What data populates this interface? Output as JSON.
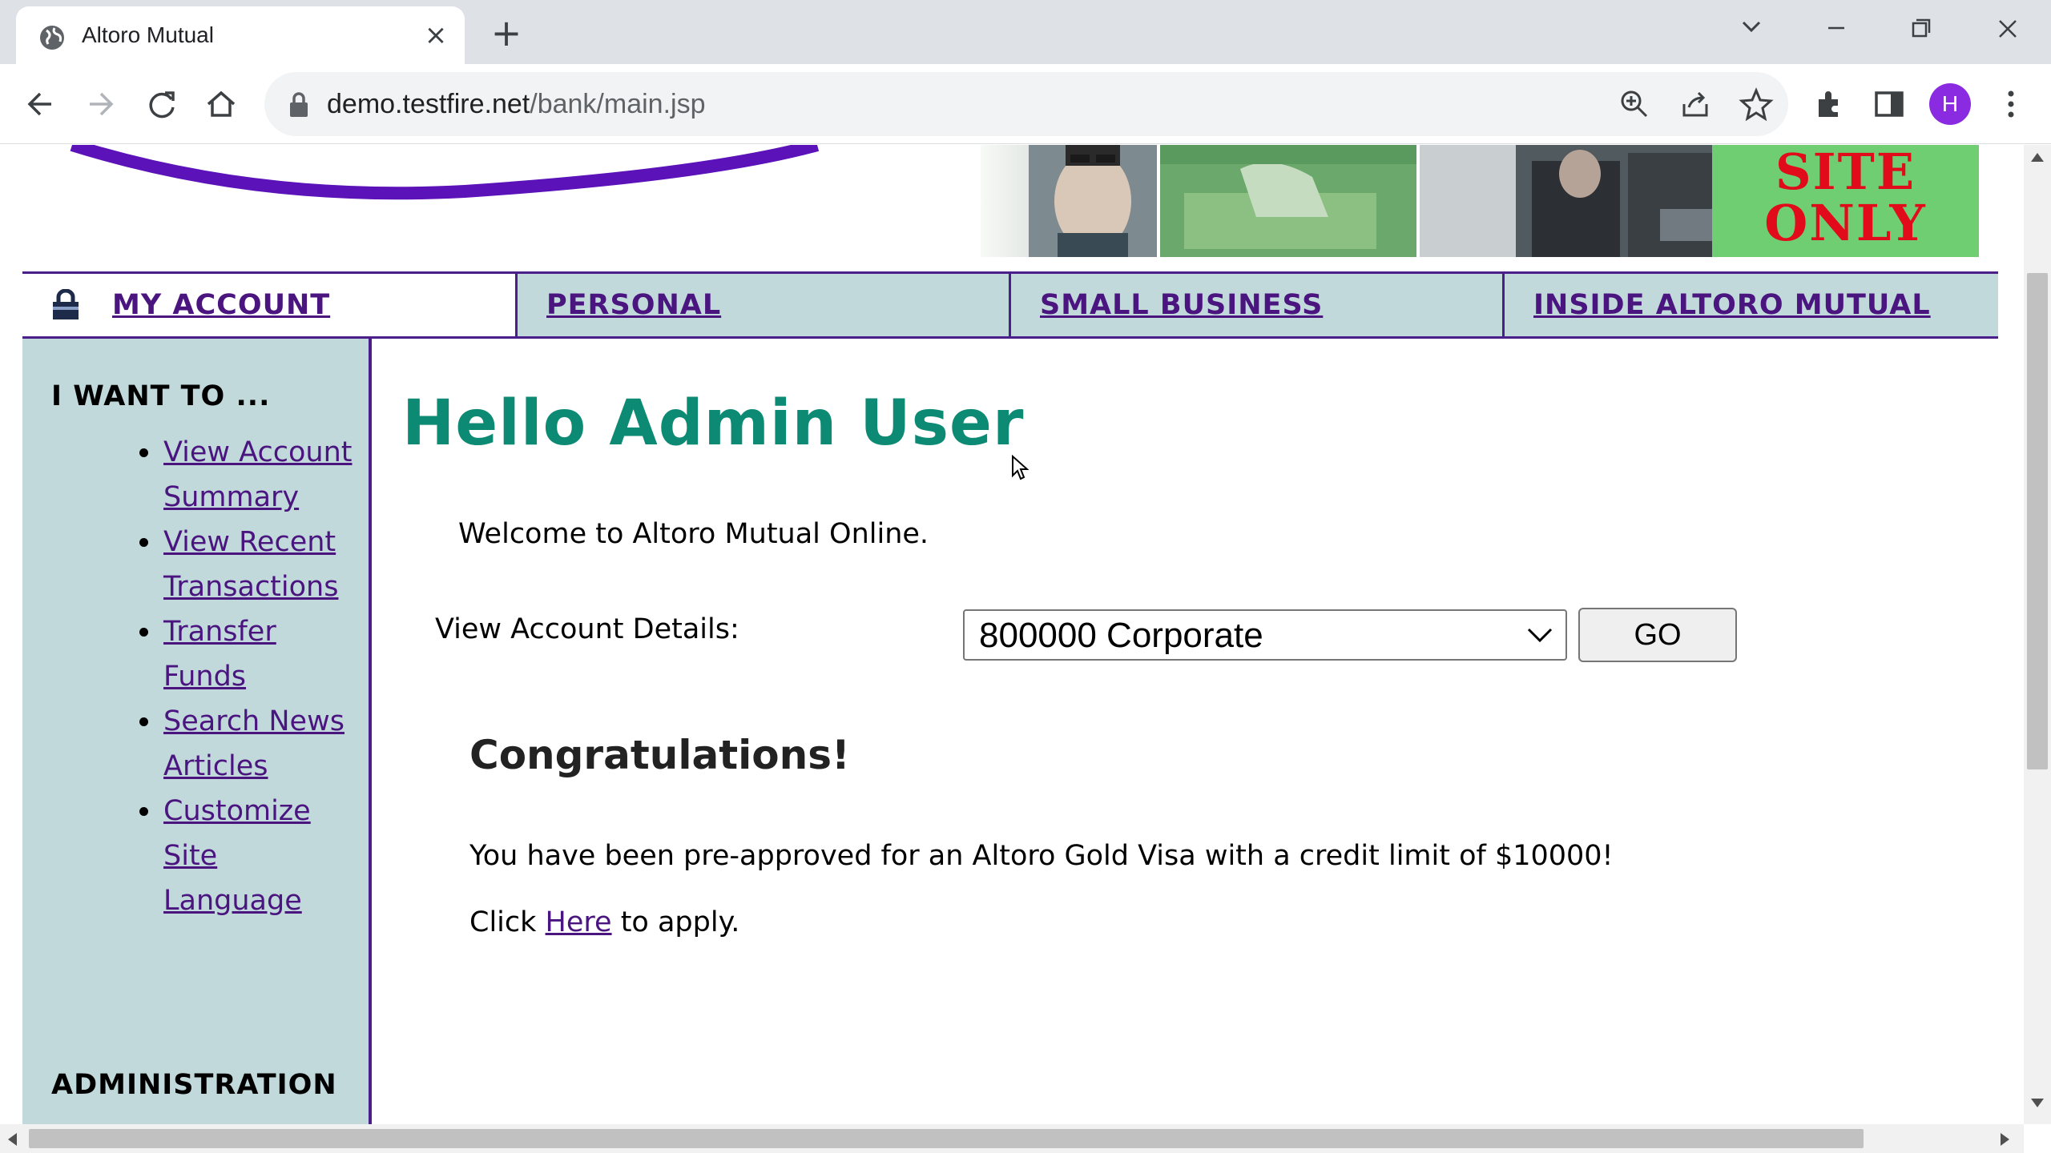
{
  "browser": {
    "tab_title": "Altoro Mutual",
    "url_host": "demo.testfire.net",
    "url_path": "/bank/main.jsp",
    "profile_initial": "H",
    "profile_color": "#8a2be2"
  },
  "banner": {
    "site_only_line1": "SITE",
    "site_only_line2": "ONLY"
  },
  "topnav": {
    "my_account": "MY ACCOUNT",
    "personal": "PERSONAL",
    "small_business": "SMALL BUSINESS",
    "inside": "INSIDE ALTORO MUTUAL"
  },
  "sidebar": {
    "heading": "I WANT TO ...",
    "items": [
      {
        "label": "View Account Summary"
      },
      {
        "label": "View Recent Transactions"
      },
      {
        "label": "Transfer Funds"
      },
      {
        "label": "Search News Articles"
      },
      {
        "label": "Customize Site Language"
      }
    ],
    "admin_heading": "ADMINISTRATION"
  },
  "main": {
    "greeting": "Hello Admin User",
    "welcome": "Welcome to Altoro Mutual Online.",
    "account_label": "View Account Details:",
    "account_selected": "800000 Corporate",
    "go_label": "GO",
    "congrats_heading": "Congratulations!",
    "offer_text": "You have been pre-approved for an Altoro Gold Visa with a credit limit of $10000!",
    "click_prefix": "Click",
    "click_link": "Here",
    "click_suffix": "to apply."
  },
  "colors": {
    "nav_border": "#4b1f8a",
    "nav_bg": "#c2d9dc",
    "link": "#4b1580",
    "greeting": "#0d8a73",
    "site_only_bg": "#6fce72",
    "site_only_text": "#e20b1b"
  }
}
